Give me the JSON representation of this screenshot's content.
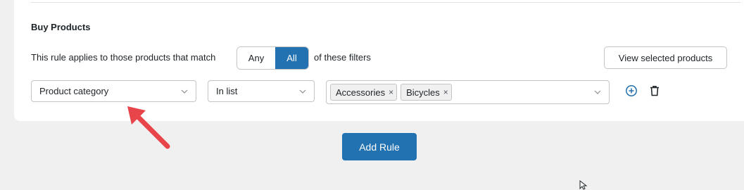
{
  "section": {
    "title": "Buy Products"
  },
  "match": {
    "prefix": "This rule applies to those products that match",
    "options": [
      "Any",
      "All"
    ],
    "selected": "All",
    "suffix": "of these filters"
  },
  "view_button": {
    "label": "View selected products"
  },
  "filter_row": {
    "field": "Product category",
    "operator": "In list",
    "values": [
      "Accessories",
      "Bicycles"
    ],
    "tag_remove_glyph": "×"
  },
  "add_rule": {
    "label": "Add Rule"
  },
  "icons": {
    "chevron": "chevron-down-icon",
    "add": "plus-circle-icon",
    "delete": "trash-icon",
    "annotation": "red-arrow",
    "cursor": "mouse-pointer"
  },
  "colors": {
    "accent": "#2271b1",
    "background": "#f0f0f1",
    "annotation": "#e8454a"
  }
}
